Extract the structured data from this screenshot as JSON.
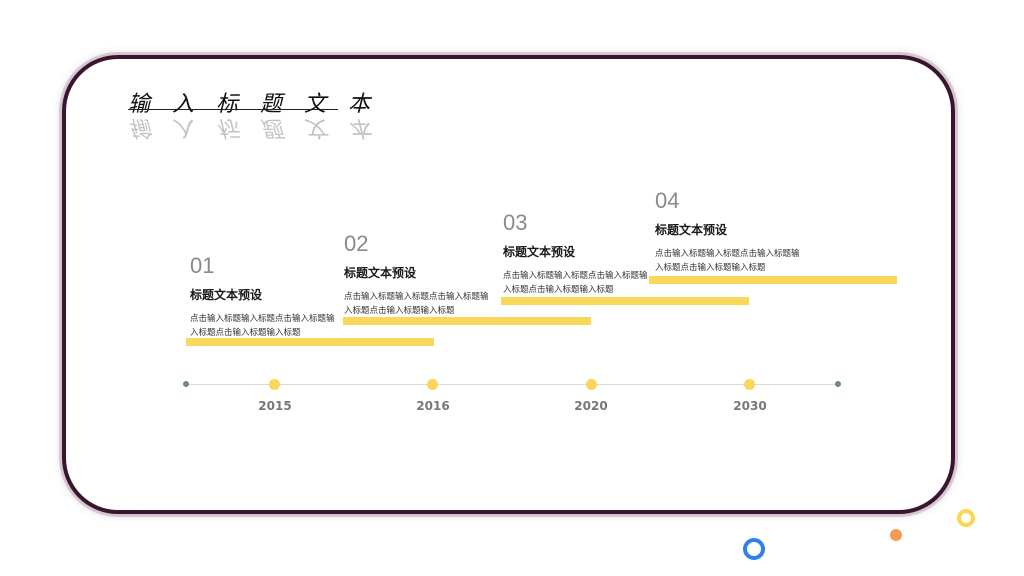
{
  "title": "输入标题文本",
  "steps": [
    {
      "num": "01",
      "heading": "标题文本预设",
      "body": "点击输入标题输入标题点击输入标题输入标题点击输入标题输入标题"
    },
    {
      "num": "02",
      "heading": "标题文本预设",
      "body": "点击输入标题输入标题点击输入标题输入标题点击输入标题输入标题"
    },
    {
      "num": "03",
      "heading": "标题文本预设",
      "body": "点击输入标题输入标题点击输入标题输入标题点击输入标题输入标题"
    },
    {
      "num": "04",
      "heading": "标题文本预设",
      "body": "点击输入标题输入标题点击输入标题输入标题点击输入标题输入标题"
    }
  ],
  "years": [
    "2015",
    "2016",
    "2020",
    "2030"
  ],
  "colors": {
    "frame": "#3a1530",
    "accent_yellow": "#f9d75a",
    "endpoint": "#6e8a7d",
    "deco_blue": "#2f7ff0",
    "deco_orange": "#f59a54",
    "deco_yellow": "#f9d750"
  }
}
